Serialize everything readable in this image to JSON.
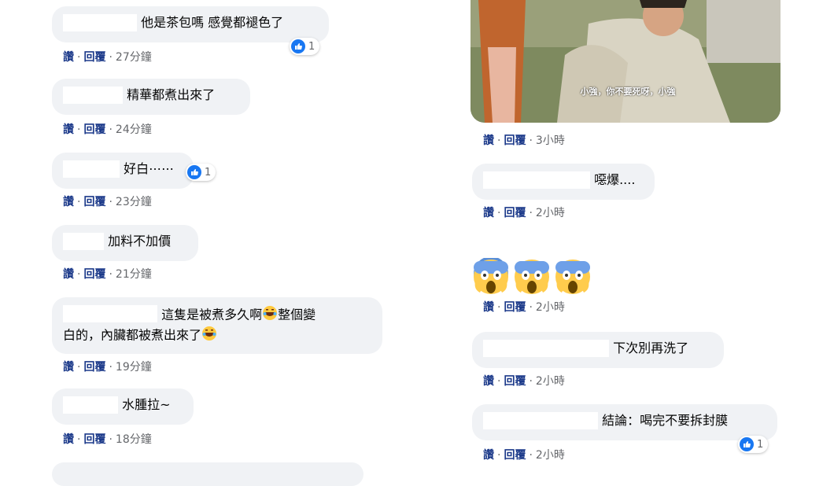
{
  "actions": {
    "like": "讚",
    "reply": "回覆"
  },
  "left_comments": [
    {
      "text": "他是茶包嗎 感覺都褪色了",
      "time": "27分鐘",
      "reactions": "1"
    },
    {
      "text": "精華都煮出來了",
      "time": "24分鐘"
    },
    {
      "text": "好白⋯⋯",
      "time": "23分鐘",
      "reactions": "1"
    },
    {
      "text": "加料不加價",
      "time": "21分鐘"
    },
    {
      "text_line1": "這隻是被煮多久啊",
      "text_line1b": "整個變",
      "text_line2": "白的，內臟都被煮出來了",
      "time": "19分鐘"
    },
    {
      "text": "水腫拉~",
      "time": "18分鐘"
    }
  ],
  "right_photo": {
    "subtitle": "小強，你不要死呀，小強"
  },
  "right_comments": [
    {
      "time": "3小時"
    },
    {
      "text": "噁爆....",
      "time": "2小時"
    },
    {
      "emoji": "scream-emoji ×3",
      "time": "2小時"
    },
    {
      "text": "下次別再洗了",
      "time": "2小時"
    },
    {
      "text": "結論：喝完不要拆封膜",
      "time": "2小時",
      "reactions": "1"
    }
  ],
  "colors": {
    "bubble": "#f0f2f5",
    "link": "#1c3a8a",
    "like_blue": "#1877f2"
  }
}
